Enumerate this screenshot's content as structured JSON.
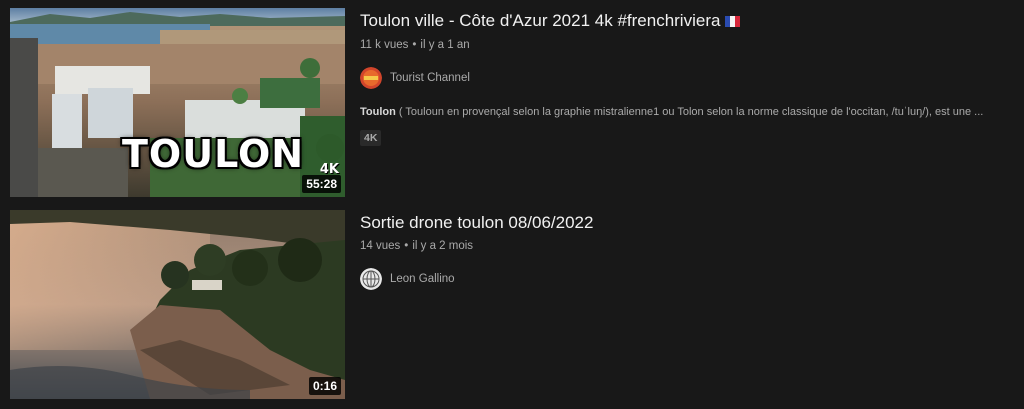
{
  "videos": [
    {
      "title": "Toulon ville - Côte d'Azur 2021 4k #frenchriviera",
      "views": "11 k vues",
      "separator": "•",
      "age": "il y a 1 an",
      "channel": "Tourist Channel",
      "description_bold": "Toulon",
      "description_rest": " ( Touloun en provençal selon la graphie mistralienne1 ou Tolon selon la norme classique de l'occitan, /tuˈluŋ/), est une ...",
      "badge": "4K",
      "duration": "55:28",
      "thumbnail_text": "TOULON",
      "thumbnail_mark": "4K",
      "avatar_icon": "tourist-channel-logo-icon",
      "flag_icon": "france-flag-icon"
    },
    {
      "title": "Sortie drone toulon 08/06/2022",
      "views": "14 vues",
      "separator": "•",
      "age": "il y a 2 mois",
      "channel": "Leon Gallino",
      "duration": "0:16",
      "avatar_icon": "globe-avatar-icon"
    }
  ],
  "colors": {
    "background": "#181818",
    "title": "#f1f1f1",
    "secondary_text": "#aaaaaa",
    "badge_bg": "#2a2a2a"
  }
}
